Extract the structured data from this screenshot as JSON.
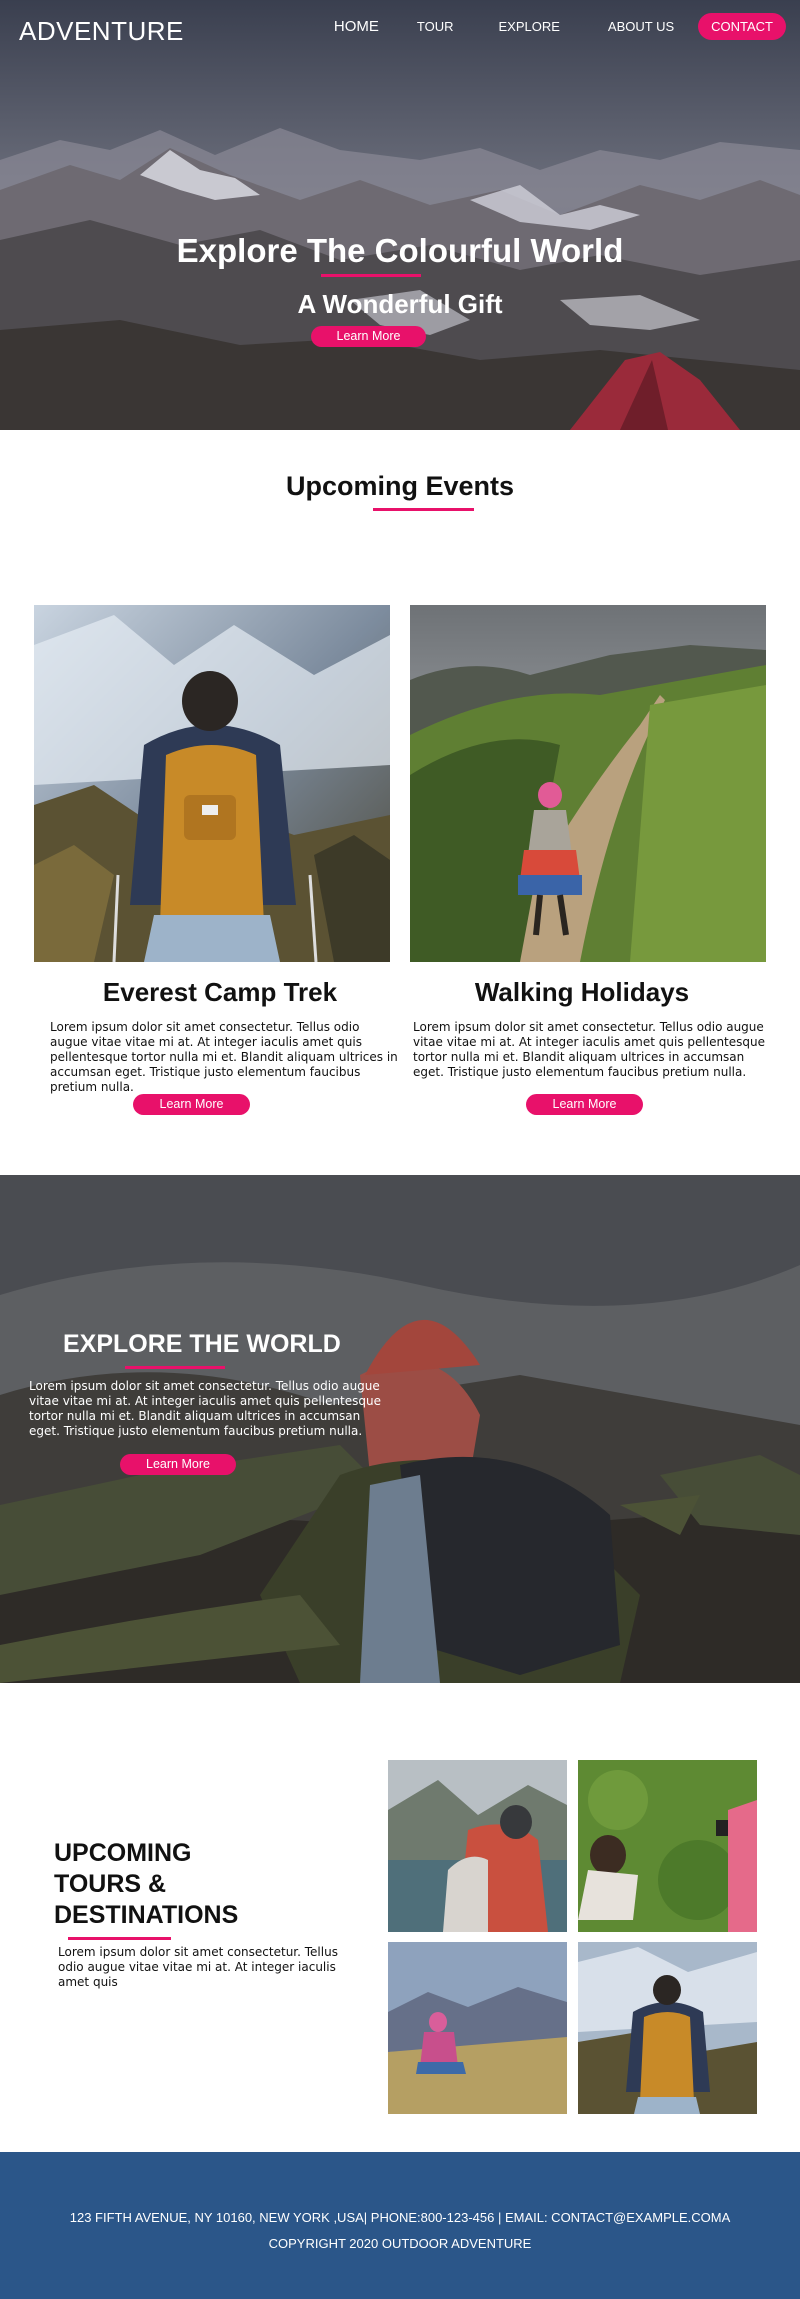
{
  "header": {
    "brand": "ADVENTURE",
    "nav": {
      "home": "HOME",
      "tour": "TOUR",
      "explore": "EXPLORE",
      "about": "ABOUT US",
      "contact": "CONTACT"
    }
  },
  "hero": {
    "title": "Explore The Colourful World",
    "subtitle": "A Wonderful Gift",
    "button": "Learn More"
  },
  "events": {
    "title": "Upcoming Events",
    "cards": [
      {
        "title": "Everest Camp Trek",
        "text": "Lorem ipsum dolor sit amet consectetur. Tellus odio augue vitae vitae mi at. At integer iaculis amet quis pellentesque tortor nulla mi et. Blandit aliquam ultrices in accumsan eget. Tristique justo elementum faucibus pretium nulla.",
        "button": "Learn More"
      },
      {
        "title": "Walking Holidays",
        "text": "Lorem ipsum dolor sit amet consectetur. Tellus odio augue vitae vitae mi at. At integer iaculis amet quis pellentesque tortor nulla mi et. Blandit aliquam ultrices in accumsan eget. Tristique justo elementum faucibus pretium nulla.",
        "button": "Learn More"
      }
    ]
  },
  "explore": {
    "title": "EXPLORE THE WORLD",
    "text": "Lorem ipsum dolor sit amet consectetur. Tellus odio augue vitae vitae mi at. At integer iaculis amet quis pellentesque tortor nulla mi et. Blandit aliquam ultrices in accumsan eget. Tristique justo elementum faucibus pretium nulla.",
    "button": "Learn More"
  },
  "tours": {
    "title": "UPCOMING TOURS & DESTINATIONS",
    "text": "Lorem ipsum dolor sit amet consectetur. Tellus odio augue vitae vitae mi at. At integer iaculis amet quis"
  },
  "footer": {
    "address": "123 FIFTH AVENUE, NY 10160, NEW YORK ,USA| PHONE:800-123-456 | EMAIL: CONTACT@EXAMPLE.COMA",
    "copyright": "COPYRIGHT  2020 OUTDOOR ADVENTURE"
  },
  "colors": {
    "accent": "#e8116a",
    "footer": "#2b5689"
  }
}
